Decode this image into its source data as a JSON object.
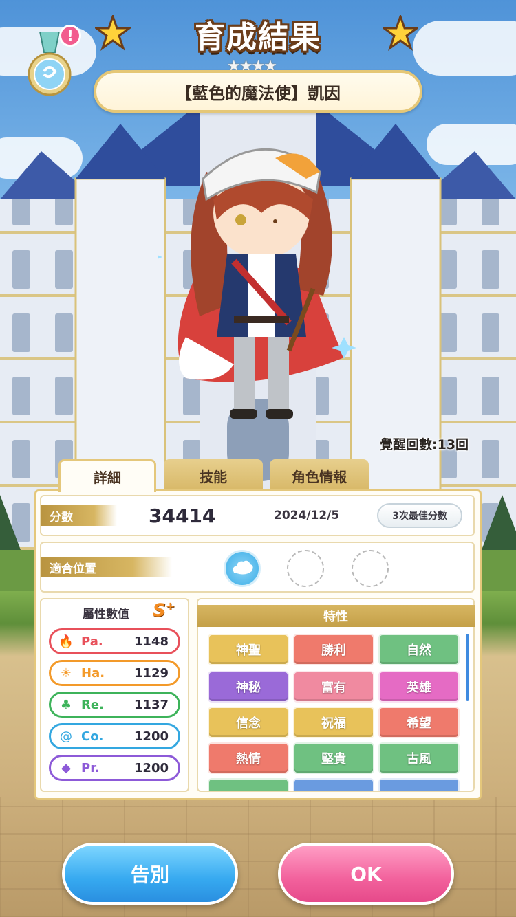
{
  "header": {
    "title": "育成結果",
    "rarity_stars": "★★★★",
    "character_name": "【藍色的魔法使】凱因",
    "notification_badge": "!"
  },
  "awakening": "覺醒回數:13回",
  "tabs": [
    {
      "label": "詳細",
      "active": true
    },
    {
      "label": "技能",
      "active": false
    },
    {
      "label": "角色情報",
      "active": false
    }
  ],
  "score_row": {
    "label": "分數",
    "score": "34414",
    "date": "2024/12/5",
    "best_button": "3次最佳分數"
  },
  "position_row": {
    "label": "適合位置",
    "slots": [
      "filled",
      "empty",
      "empty"
    ]
  },
  "attributes": {
    "title": "屬性數值",
    "rank": "S",
    "rank_plus": "+",
    "items": [
      {
        "name": "Pa.",
        "value": "1148",
        "color": "#e8505a",
        "icon": "flame-icon"
      },
      {
        "name": "Ha.",
        "value": "1129",
        "color": "#f39a2a",
        "icon": "sun-icon"
      },
      {
        "name": "Re.",
        "value": "1137",
        "color": "#3db35a",
        "icon": "clover-icon"
      },
      {
        "name": "Co.",
        "value": "1200",
        "color": "#33a7e0",
        "icon": "swirl-icon"
      },
      {
        "name": "Pr.",
        "value": "1200",
        "color": "#8d5ad8",
        "icon": "diamond-icon"
      }
    ]
  },
  "traits": {
    "title": "特性",
    "items": [
      {
        "label": "神聖",
        "color": "#e8c25a"
      },
      {
        "label": "勝利",
        "color": "#ef7a6c"
      },
      {
        "label": "自然",
        "color": "#6fc181"
      },
      {
        "label": "神秘",
        "color": "#9a6ad8"
      },
      {
        "label": "富有",
        "color": "#f08aa0"
      },
      {
        "label": "英雄",
        "color": "#e56bc4"
      },
      {
        "label": "信念",
        "color": "#e8c25a"
      },
      {
        "label": "祝福",
        "color": "#e8c25a"
      },
      {
        "label": "希望",
        "color": "#ef7a6c"
      },
      {
        "label": "熱情",
        "color": "#ef7a6c"
      },
      {
        "label": "堅貴",
        "color": "#6fc181"
      },
      {
        "label": "古風",
        "color": "#6fc181"
      }
    ]
  },
  "buttons": {
    "farewell": "告別",
    "ok": "OK"
  }
}
